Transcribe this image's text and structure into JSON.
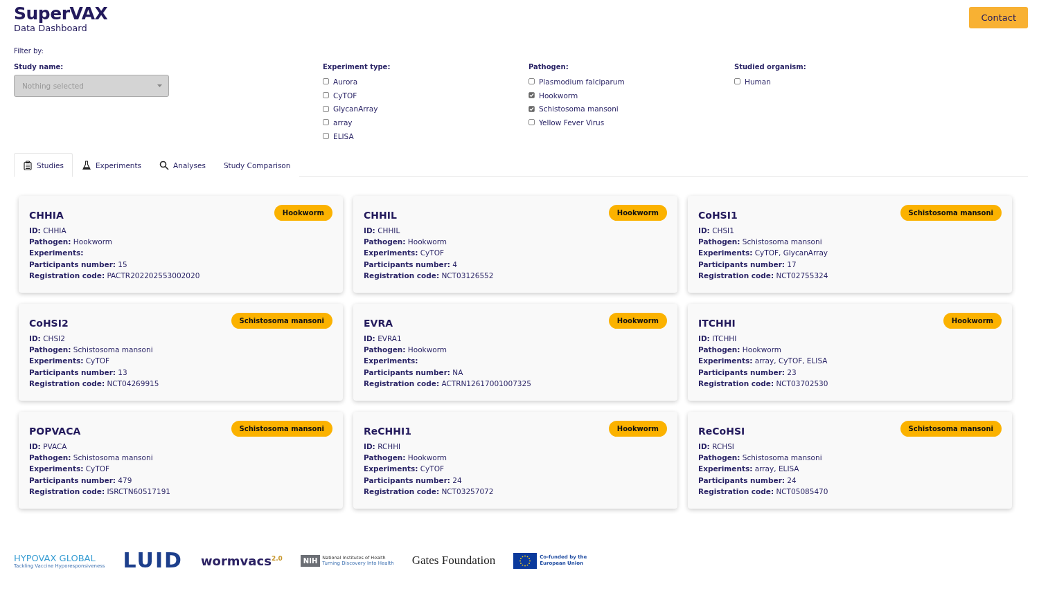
{
  "header": {
    "title": "SuperVAX",
    "subtitle": "Data Dashboard",
    "contact": "Contact"
  },
  "filters": {
    "label": "Filter by:",
    "study_name": {
      "label": "Study name:",
      "placeholder": "Nothing selected"
    },
    "groups": [
      {
        "label": "Experiment type:",
        "options": [
          {
            "label": "Aurora",
            "checked": false
          },
          {
            "label": "CyTOF",
            "checked": false
          },
          {
            "label": "GlycanArray",
            "checked": false
          },
          {
            "label": "array",
            "checked": false
          },
          {
            "label": "ELISA",
            "checked": false
          }
        ]
      },
      {
        "label": "Pathogen:",
        "options": [
          {
            "label": "Plasmodium falciparum",
            "checked": false
          },
          {
            "label": "Hookworm",
            "checked": true
          },
          {
            "label": "Schistosoma mansoni",
            "checked": true
          },
          {
            "label": "Yellow Fever Virus",
            "checked": false
          }
        ]
      },
      {
        "label": "Studied organism:",
        "options": [
          {
            "label": "Human",
            "checked": false
          }
        ]
      }
    ]
  },
  "tabs": [
    {
      "label": "Studies",
      "selected": true
    },
    {
      "label": "Experiments",
      "selected": false
    },
    {
      "label": "Analyses",
      "selected": false
    },
    {
      "label": "Study Comparison",
      "selected": false
    }
  ],
  "studies": [
    {
      "title": "CHHIA",
      "tag": "Hookworm",
      "fields": [
        {
          "label": "ID:",
          "value": "CHHIA"
        },
        {
          "label": "Pathogen:",
          "value": "Hookworm"
        },
        {
          "label": "Experiments:"
        },
        {
          "label": "Participants number:",
          "value": "15"
        },
        {
          "label": "Registration code:",
          "value": "PACTR202202553002020"
        }
      ]
    },
    {
      "title": "CHHIL",
      "tag": "Hookworm",
      "fields": [
        {
          "label": "ID:",
          "value": "CHHIL"
        },
        {
          "label": "Pathogen:",
          "value": "Hookworm"
        },
        {
          "label": "Experiments:",
          "value": "CyTOF"
        },
        {
          "label": "Participants number:",
          "value": "4"
        },
        {
          "label": "Registration code:",
          "value": "NCT03126552"
        }
      ]
    },
    {
      "title": "CoHSI1",
      "tag": "Schistosoma mansoni",
      "fields": [
        {
          "label": "ID:",
          "value": "CHSI1"
        },
        {
          "label": "Pathogen:",
          "value": "Schistosoma mansoni"
        },
        {
          "label": "Experiments:",
          "value": "CyTOF, GlycanArray"
        },
        {
          "label": "Participants number:",
          "value": "17"
        },
        {
          "label": "Registration code:",
          "value": "NCT02755324"
        }
      ]
    },
    {
      "title": "CoHSI2",
      "tag": "Schistosoma mansoni",
      "fields": [
        {
          "label": "ID:",
          "value": "CHSI2"
        },
        {
          "label": "Pathogen:",
          "value": "Schistosoma mansoni"
        },
        {
          "label": "Experiments:",
          "value": "CyTOF"
        },
        {
          "label": "Participants number:",
          "value": "13"
        },
        {
          "label": "Registration code:",
          "value": "NCT04269915"
        }
      ]
    },
    {
      "title": "EVRA",
      "tag": "Hookworm",
      "fields": [
        {
          "label": "ID:",
          "value": "EVRA1"
        },
        {
          "label": "Pathogen:",
          "value": "Hookworm"
        },
        {
          "label": "Experiments:"
        },
        {
          "label": "Participants number:",
          "value": "NA"
        },
        {
          "label": "Registration code:",
          "value": "ACTRN12617001007325"
        }
      ]
    },
    {
      "title": "ITCHHI",
      "tag": "Hookworm",
      "fields": [
        {
          "label": "ID:",
          "value": "ITCHHI"
        },
        {
          "label": "Pathogen:",
          "value": "Hookworm"
        },
        {
          "label": "Experiments:",
          "value": "array, CyTOF, ELISA"
        },
        {
          "label": "Participants number:",
          "value": "23"
        },
        {
          "label": "Registration code:",
          "value": "NCT03702530"
        }
      ]
    },
    {
      "title": "POPVACA",
      "tag": "Schistosoma mansoni",
      "fields": [
        {
          "label": "ID:",
          "value": "PVACA"
        },
        {
          "label": "Pathogen:",
          "value": "Schistosoma mansoni"
        },
        {
          "label": "Experiments:",
          "value": "CyTOF"
        },
        {
          "label": "Participants number:",
          "value": "479"
        },
        {
          "label": "Registration code:",
          "value": "ISRCTN60517191"
        }
      ]
    },
    {
      "title": "ReCHHI1",
      "tag": "Hookworm",
      "fields": [
        {
          "label": "ID:",
          "value": "RCHHI"
        },
        {
          "label": "Pathogen:",
          "value": "Hookworm"
        },
        {
          "label": "Experiments:",
          "value": "CyTOF"
        },
        {
          "label": "Participants number:",
          "value": "24"
        },
        {
          "label": "Registration code:",
          "value": "NCT03257072"
        }
      ]
    },
    {
      "title": "ReCoHSI",
      "tag": "Schistosoma mansoni",
      "fields": [
        {
          "label": "ID:",
          "value": "RCHSI"
        },
        {
          "label": "Pathogen:",
          "value": "Schistosoma mansoni"
        },
        {
          "label": "Experiments:",
          "value": "array, ELISA"
        },
        {
          "label": "Participants number:",
          "value": "24"
        },
        {
          "label": "Registration code:",
          "value": "NCT05085470"
        }
      ]
    }
  ],
  "logos": [
    {
      "kind": "hypovax",
      "text": "HYPOVAX GLOBAL",
      "tagline": "Tackling Vaccine Hyporesponsiveness"
    },
    {
      "kind": "luid",
      "text": "LUID"
    },
    {
      "kind": "wormvacs",
      "text": "wormvacs",
      "sup": "2.0"
    },
    {
      "kind": "nih",
      "badge": "NIH",
      "text": "National Institutes of Health",
      "tagline": "Turning Discovery Into Health"
    },
    {
      "kind": "gates",
      "text": "Gates Foundation"
    },
    {
      "kind": "eu",
      "text": "Co-funded by the European Union"
    }
  ]
}
